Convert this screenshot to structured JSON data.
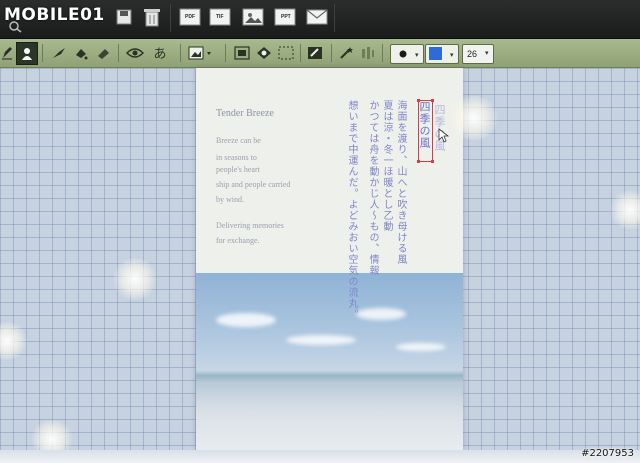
{
  "brand": {
    "logo_text": "MOBILE01"
  },
  "top_toolbar": {
    "pdf_label": "PDF",
    "tif_label": "TIF",
    "ppt_label": "PPT"
  },
  "format_toolbar": {
    "kana_label": "あ",
    "text_color": "#1a1a1a",
    "fill_color": "#2f6bd6",
    "font_size": "26"
  },
  "document": {
    "en_title": "Tender Breeze",
    "en_lines": [
      "Breeze can be",
      "in seasons to",
      "people's heart",
      "ship and people carried",
      "by wind.",
      "Delivering memories",
      "for exchange."
    ],
    "jp_title_faint": "四季の風",
    "jp_title": "四季の風",
    "jp_columns": [
      "海面を渡り、山へと吹き母ける風",
      "夏は涼・冬一ほ暖とし乙動",
      "かつては舟を動かじ人〜もの、情報",
      "想いまで中運んだ。よどみおい空気の流丸。"
    ]
  },
  "watermark": "#2207953"
}
